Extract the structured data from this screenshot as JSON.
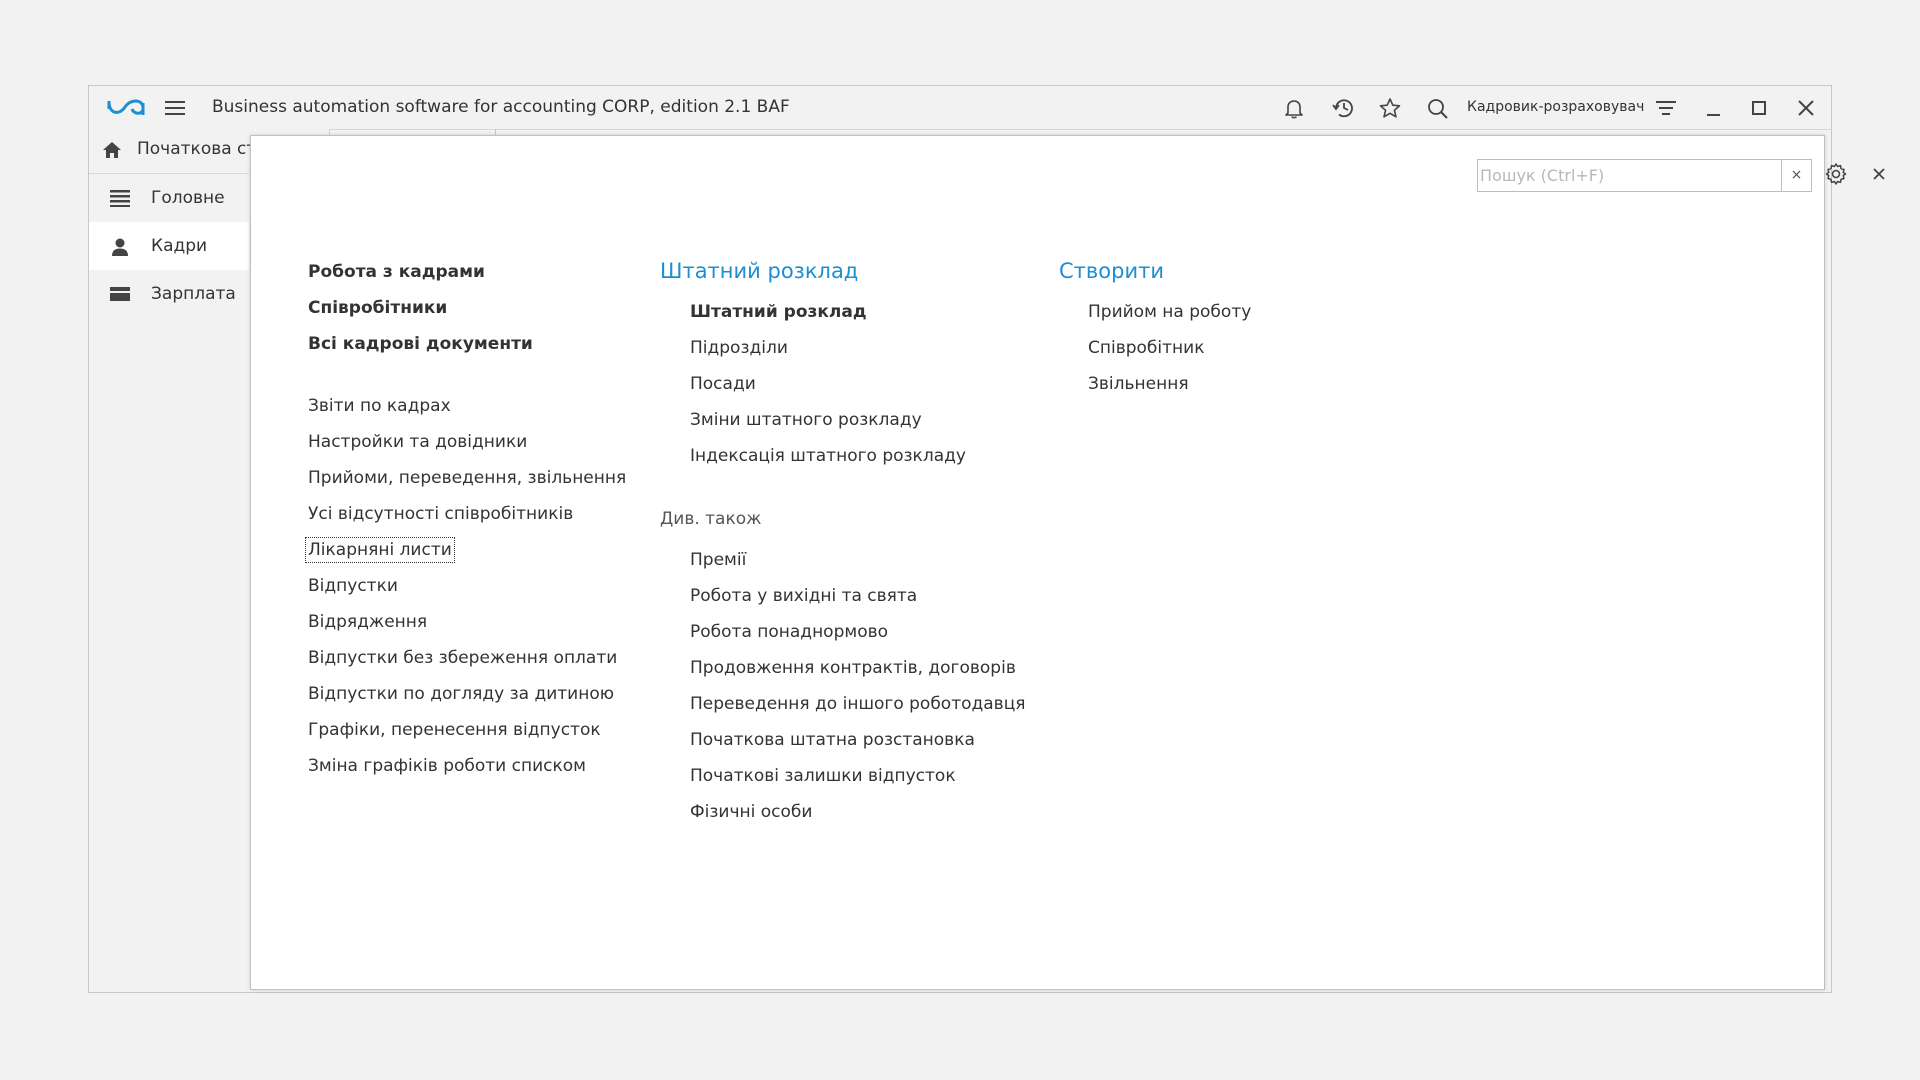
{
  "app": {
    "title": "Business automation software for accounting CORP, edition 2.1 BAF",
    "user": "Кадровик-розраховувач"
  },
  "icons": {
    "logo": "baf-logo-icon",
    "menu": "hamburger-icon",
    "notifications": "bell-icon",
    "history": "history-icon",
    "favorites": "star-icon",
    "search": "search-icon",
    "settings": "filter-lines-icon",
    "minimize": "minimize-icon",
    "maximize": "maximize-icon",
    "close": "close-icon"
  },
  "tabs": {
    "home": "Початкова сто"
  },
  "sidebar": {
    "items": [
      {
        "label": "Головне",
        "icon": "list-icon"
      },
      {
        "label": "Кадри",
        "icon": "person-icon"
      },
      {
        "label": "Зарплата",
        "icon": "wallet-icon"
      }
    ]
  },
  "panel": {
    "search_placeholder": "Пошук (Ctrl+F)",
    "search_clear": "×",
    "col1": {
      "main_links": [
        "Робота з кадрами",
        "Співробітники",
        "Всі кадрові документи"
      ],
      "links": [
        "Звіти по кадрах",
        "Настройки та довідники",
        "Прийоми, переведення, звільнення",
        "Усі відсутності співробітників",
        "Лікарняні листи",
        "Відпустки",
        "Відрядження",
        "Відпустки без збереження оплати",
        "Відпустки по догляду за дитиною",
        "Графіки, перенесення відпусток",
        "Зміна графіків роботи списком"
      ]
    },
    "col2": {
      "heading": "Штатний розклад",
      "main_link": "Штатний розклад",
      "links": [
        "Підрозділи",
        "Посади",
        "Зміни штатного розкладу",
        "Індексація штатного розкладу"
      ],
      "see_also_label": "Див. також",
      "see_also": [
        "Премії",
        "Робота у вихідні та свята",
        "Робота понаднормово",
        "Продовження контрактів, договорів",
        "Переведення до іншого роботодавця",
        "Початкова штатна розстановка",
        "Початкові залишки відпусток",
        "Фізичні особи"
      ]
    },
    "col3": {
      "heading": "Створити",
      "links": [
        "Прийом на роботу",
        "Співробітник",
        "Звільнення"
      ]
    }
  },
  "colors": {
    "accent": "#1d8ed1",
    "text": "#333333",
    "background": "#f2f2f2"
  }
}
